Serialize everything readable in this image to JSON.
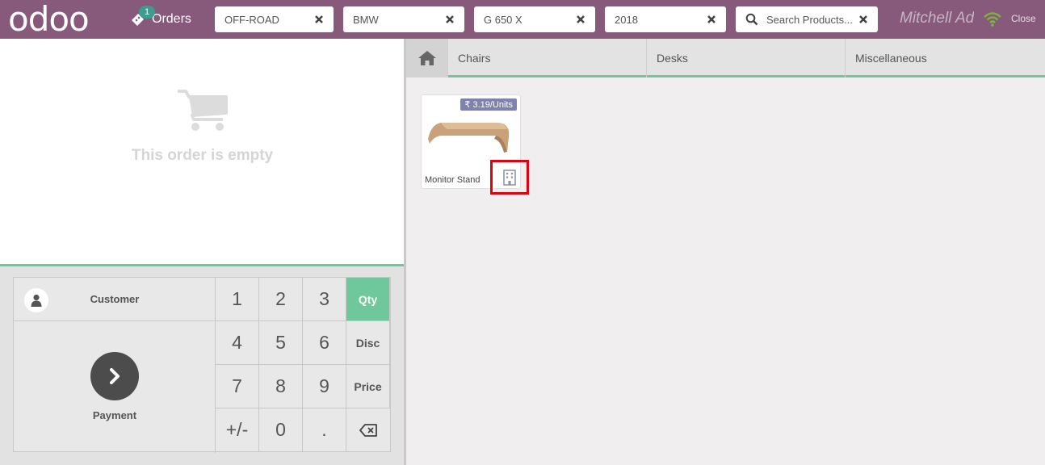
{
  "header": {
    "logo": "odoo",
    "orders_label": "Orders",
    "orders_count": "1",
    "filters": [
      "OFF-ROAD",
      "BMW",
      "G 650 X",
      "2018"
    ],
    "search_placeholder": "Search Products...",
    "cashier": "Mitchell Admin",
    "close_label": "Close",
    "wifi_color": "#7ab43b",
    "bar_color": "#875a7b"
  },
  "order": {
    "empty_text": "This order is empty"
  },
  "pad": {
    "customer_label": "Customer",
    "payment_label": "Payment",
    "keys": [
      "1",
      "2",
      "3",
      "4",
      "5",
      "6",
      "7",
      "8",
      "9",
      "+/-",
      "0",
      "."
    ],
    "modes": [
      "Qty",
      "Disc",
      "Price"
    ],
    "active_mode": "Qty",
    "accent_color": "#6ec89b"
  },
  "categories": {
    "home_icon": "home-icon",
    "items": [
      "Chairs",
      "Desks",
      "Miscellaneous"
    ]
  },
  "products": [
    {
      "name": "Monitor Stand",
      "price": "₹ 3.19/Units"
    }
  ]
}
